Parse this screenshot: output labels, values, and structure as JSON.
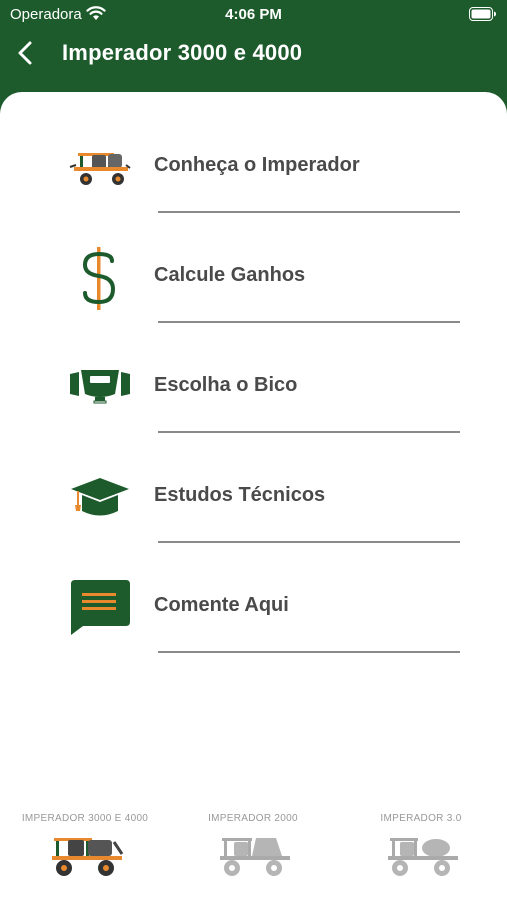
{
  "status_bar": {
    "carrier": "Operadora",
    "time": "4:06 PM"
  },
  "header": {
    "title": "Imperador 3000 e 4000",
    "back_icon": "chevron-left-icon"
  },
  "menu": {
    "items": [
      {
        "label": "Conheça o Imperador",
        "icon": "sprayer-icon"
      },
      {
        "label": "Calcule Ganhos",
        "icon": "dollar-icon"
      },
      {
        "label": "Escolha o Bico",
        "icon": "nozzle-icon"
      },
      {
        "label": "Estudos Técnicos",
        "icon": "graduation-cap-icon"
      },
      {
        "label": "Comente Aqui",
        "icon": "chat-bubble-icon"
      }
    ]
  },
  "tabs": [
    {
      "label": "IMPERADOR 3000 E 4000",
      "selected": true
    },
    {
      "label": "IMPERADOR 2000",
      "selected": false
    },
    {
      "label": "IMPERADOR 3.0",
      "selected": false
    }
  ],
  "colors": {
    "brand_green": "#1d5a2c",
    "accent_orange": "#e8892e",
    "text_gray": "#4a4a4a",
    "inactive_gray": "#999999"
  }
}
